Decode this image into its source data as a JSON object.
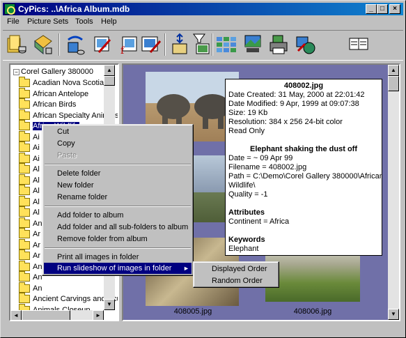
{
  "window": {
    "title": "CyPics: ..\\Africa Album.mdb",
    "min_glyph": "_",
    "max_glyph": "□",
    "close_glyph": "×"
  },
  "menu": {
    "file": "File",
    "picture_sets": "Picture Sets",
    "tools": "Tools",
    "help": "Help"
  },
  "toolbar": {
    "buttons": [
      "open-album-icon",
      "open-collection-icon",
      "refresh-database-icon",
      "edit-picture-icon",
      "edit-script-icon",
      "edit-set-icon",
      "sort-icon",
      "filter-icon",
      "thumbnail-view-icon",
      "slideshow-icon",
      "printer-icon",
      "web-export-icon",
      "book-help-icon"
    ]
  },
  "tree": {
    "root": "Corel Gallery 380000",
    "expander_minus": "−",
    "expander_plus": "+",
    "items": [
      "Acadian Nova Scotia",
      "African Antelope",
      "African Birds",
      "African Specialty Animals",
      "Africa Wildlife",
      "Ai",
      "Ai",
      "Ai",
      "Al",
      "Al",
      "Al",
      "Al",
      "Al",
      "An",
      "Ar",
      "Ar",
      "Ar",
      "An",
      "An",
      "An",
      "Ancient Carvings and Sculpture",
      "Animals Closeup",
      "Antiquity"
    ]
  },
  "scroll": {
    "up": "▲",
    "down": "▼",
    "left": "◄",
    "right": "►"
  },
  "thumbnails": {
    "captions": [
      "408005.jpg",
      "408006.jpg",
      "jpg",
      "jpg"
    ]
  },
  "context_menu": {
    "items": [
      "Cut",
      "Copy",
      "Paste",
      "Delete folder",
      "New folder",
      "Rename folder",
      "Add folder to album",
      "Add folder and all sub-folders to album",
      "Remove folder from album",
      "Print all images in folder",
      "Run slideshow of images in folder"
    ],
    "submenu_arrow": "►",
    "submenu": [
      "Displayed Order",
      "Random Order"
    ]
  },
  "tooltip": {
    "filename": "408002.jpg",
    "date_created": "Date Created: 31 May, 2000 at 22:01:42",
    "date_modified": "Date Modified: 9 Apr, 1999 at 09:07:38",
    "size": "Size: 19 Kb",
    "resolution": "Resolution: 384 x 256 24-bit color",
    "read_only": "Read Only",
    "caption": "Elephant shaking the dust off",
    "date": "Date = ~ 09 Apr 99",
    "filename_line": "Filename = 408002.jpg",
    "path1": "Path = C:\\Demo\\Corel Gallery 380000\\African",
    "path2": "Wildlife\\",
    "quality": "Quality = -1",
    "attributes_head": "Attributes",
    "continent": "Continent = Africa",
    "keywords_head": "Keywords",
    "keyword": "Elephant"
  }
}
